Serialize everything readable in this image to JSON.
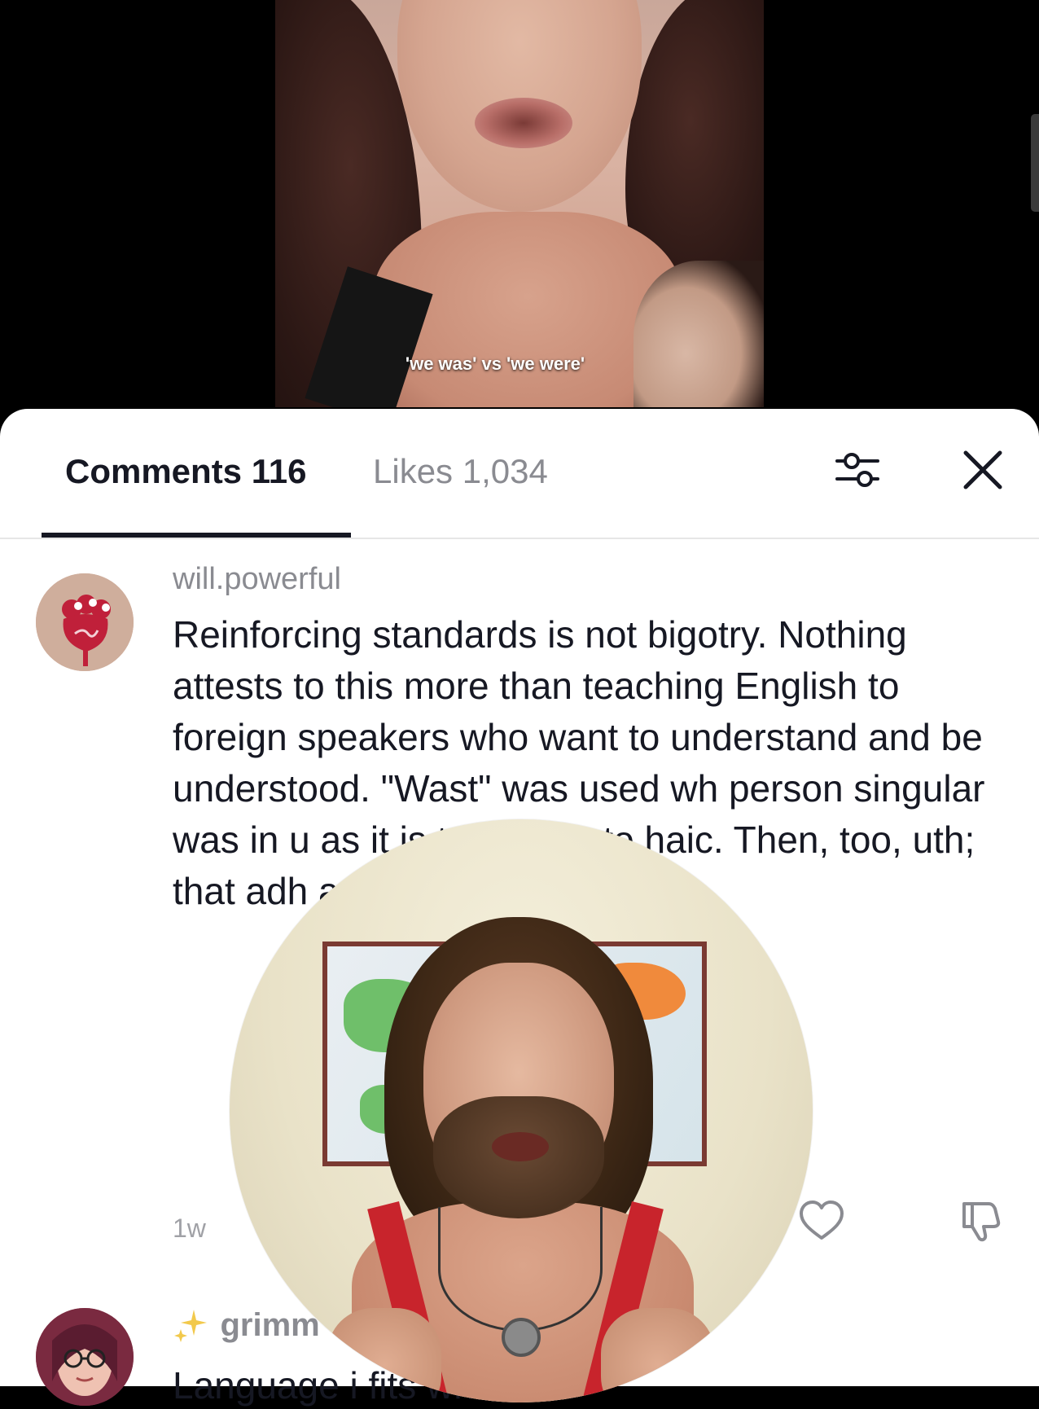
{
  "video": {
    "caption": "'we was' vs 'we were'"
  },
  "comments_panel": {
    "tabs": [
      {
        "label": "Comments 116",
        "active": true
      },
      {
        "label": "Likes 1,034",
        "active": false
      }
    ],
    "filter_icon": "sliders-icon",
    "close_icon": "close-icon"
  },
  "comments": [
    {
      "username": "will.powerful",
      "text": "Reinforcing standards is not bigotry. Nothing attests to this more than teaching English to foreign speakers who want to understand and be understood. \"Wast\" was used wh person singular was in u as it is today. So to haic. Then, too, uth; that adh ards of Eng reshly pre",
      "time": "1w",
      "like_icon": "heart-outline-icon",
      "dislike_icon": "thumbs-down-icon"
    },
    {
      "username": "grimm",
      "badge_icon": "sparkle-icon",
      "text": "Language i fits whatever"
    }
  ],
  "colors": {
    "text_primary": "#161823",
    "text_secondary": "#8a8b91",
    "accent_underline": "#161823",
    "sheet_background": "#ffffff"
  }
}
